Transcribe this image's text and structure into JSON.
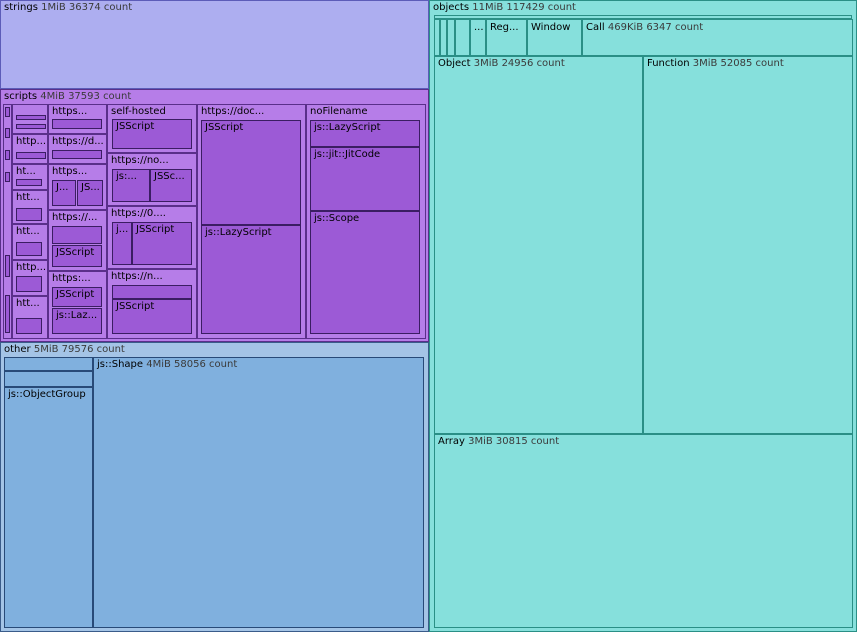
{
  "treemap": {
    "strings": {
      "name": "strings",
      "meta": "1MiB 36374 count"
    },
    "scripts": {
      "name": "scripts",
      "meta": "4MiB 37593 count",
      "children": [
        {
          "label": "https..."
        },
        {
          "label": "https://d..."
        },
        {
          "label": "https..."
        },
        {
          "label": "https://..."
        },
        {
          "label": "https:..."
        },
        {
          "label": "http..."
        },
        {
          "label": "ht..."
        },
        {
          "label": "htt..."
        },
        {
          "label": "htt..."
        },
        {
          "label": "http..."
        },
        {
          "label": "htt..."
        },
        {
          "label": "self-hosted"
        },
        {
          "label": "https://no..."
        },
        {
          "label": "https://0...."
        },
        {
          "label": "https://n..."
        },
        {
          "label": "https://doc..."
        },
        {
          "label": "noFilename"
        }
      ],
      "leaf_labels": {
        "jsscript": "JSScript",
        "js_short": "js:...",
        "jssc": "JSSc...",
        "j_short": "J...",
        "js_short2": "JS...",
        "j_dots": "j...",
        "js_laz": "js::Laz...",
        "lazy": "js::LazyScript",
        "jit": "js::jit::JitCode",
        "scope": "js::Scope"
      }
    },
    "other": {
      "name": "other",
      "meta": "5MiB 79576 count",
      "shape": {
        "name": "js::Shape",
        "meta": "4MiB 58056 count"
      },
      "objectgroup": {
        "name": "js::ObjectGroup"
      }
    },
    "objects": {
      "name": "objects",
      "meta": "11MiB 117429 count",
      "small": [
        {
          "label": "..."
        },
        {
          "label": "Reg..."
        },
        {
          "label": "Window"
        }
      ],
      "call": {
        "name": "Call",
        "meta": "469KiB 6347 count"
      },
      "object": {
        "name": "Object",
        "meta": "3MiB 24956 count"
      },
      "function": {
        "name": "Function",
        "meta": "3MiB 52085 count"
      },
      "array": {
        "name": "Array",
        "meta": "3MiB 30815 count"
      }
    }
  },
  "colors": {
    "strings": "#adaef0",
    "scripts": "#b67de8",
    "scripts_deep": "#9c5ad6",
    "other": "#a4c4e6",
    "objects": "#86e0dc"
  }
}
